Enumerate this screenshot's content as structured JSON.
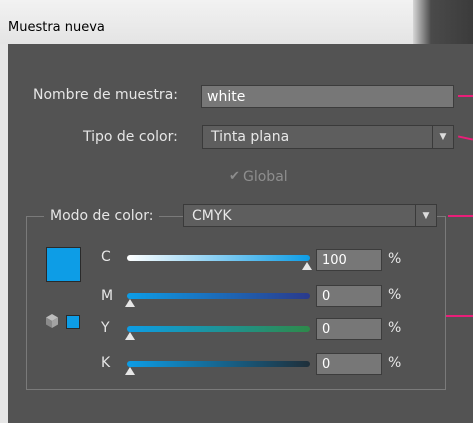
{
  "window": {
    "title": "Muestra nueva"
  },
  "form": {
    "swatch_name_label": "Nombre de muestra:",
    "swatch_name_value": "white",
    "color_type_label": "Tipo de color:",
    "color_type_value": "Tinta plana",
    "global_label": "Global",
    "global_checked": true,
    "global_enabled": false,
    "color_mode_label": "Modo de color:",
    "color_mode_value": "CMYK"
  },
  "swatch_color": "#0d9de6",
  "channels": [
    {
      "label": "C",
      "value": "100",
      "unit": "%",
      "fraction": 1.0
    },
    {
      "label": "M",
      "value": "0",
      "unit": "%",
      "fraction": 0.0
    },
    {
      "label": "Y",
      "value": "0",
      "unit": "%",
      "fraction": 0.0
    },
    {
      "label": "K",
      "value": "0",
      "unit": "%",
      "fraction": 0.0
    }
  ],
  "icons": {
    "dropdown": "triangle-down",
    "checkbox": "checkmark",
    "gamut": "cube"
  },
  "colors": {
    "callout_lines": "#e91e79",
    "panel_bg": "#535353"
  }
}
